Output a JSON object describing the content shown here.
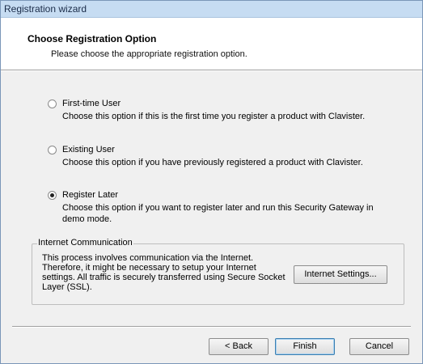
{
  "window": {
    "title": "Registration wizard"
  },
  "header": {
    "title": "Choose Registration Option",
    "subtitle": "Please choose the appropriate registration option."
  },
  "options": [
    {
      "label": "First-time User",
      "description": "Choose this option if this is the first time you register a product with Clavister.",
      "selected": false
    },
    {
      "label": "Existing User",
      "description": "Choose this option if you have previously registered a product with Clavister.",
      "selected": false
    },
    {
      "label": "Register Later",
      "description": "Choose this option if you want to register later and run this Security Gateway in demo mode.",
      "selected": true
    }
  ],
  "internet": {
    "group_label": "Internet Communication",
    "text": "This process involves communication via the Internet. Therefore, it might be necessary to setup your Internet settings. All traffic is securely transferred using Secure Socket Layer (SSL).",
    "settings_button": "Internet Settings..."
  },
  "footer": {
    "back_label": "< Back",
    "finish_label": "Finish",
    "cancel_label": "Cancel"
  }
}
